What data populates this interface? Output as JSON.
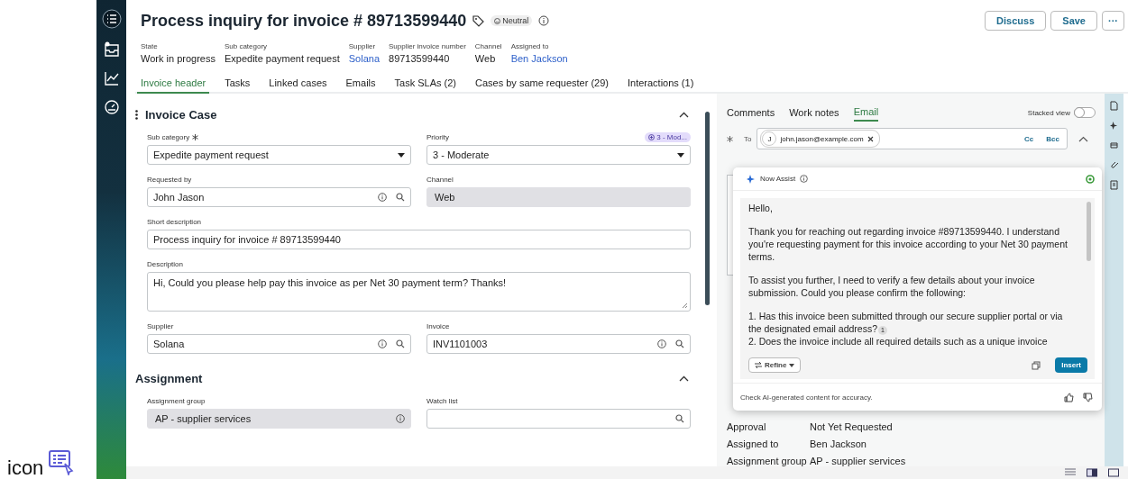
{
  "caption": {
    "text": "icon"
  },
  "header": {
    "title": "Process inquiry for invoice # 89713599440",
    "sentiment": "Neutral",
    "buttons": [
      {
        "label": "Discuss",
        "kind": "text"
      },
      {
        "label": "Save",
        "kind": "text"
      },
      {
        "label": "···",
        "kind": "more"
      }
    ]
  },
  "summary": [
    {
      "label": "State",
      "value": "Work in progress",
      "link": false
    },
    {
      "label": "Sub category",
      "value": "Expedite payment request",
      "link": false
    },
    {
      "label": "Supplier",
      "value": "Solana",
      "link": true
    },
    {
      "label": "Supplier invoice number",
      "value": "89713599440",
      "link": false
    },
    {
      "label": "Channel",
      "value": "Web",
      "link": false
    },
    {
      "label": "Assigned to",
      "value": "Ben Jackson",
      "link": true
    }
  ],
  "tabs": [
    {
      "label": "Invoice header",
      "selected": true
    },
    {
      "label": "Tasks",
      "selected": false
    },
    {
      "label": "Linked cases",
      "selected": false
    },
    {
      "label": "Emails",
      "selected": false
    },
    {
      "label": "Task SLAs (2)",
      "selected": false
    },
    {
      "label": "Cases by same requester (29)",
      "selected": false
    },
    {
      "label": "Interactions (1)",
      "selected": false
    }
  ],
  "sections": [
    {
      "title": "Invoice Case",
      "expanded": true,
      "fields": [
        {
          "label": "Sub category",
          "value": "Expedite payment request",
          "kind": "select",
          "required": true
        },
        {
          "label": "Priority",
          "value": "3 - Moderate",
          "kind": "select",
          "required": false,
          "badge": "3 - Mod..."
        },
        {
          "label": "Requested by",
          "value": "John Jason",
          "kind": "lookup",
          "required": false
        },
        {
          "label": "Channel",
          "value": "Web",
          "kind": "readonly",
          "required": false
        },
        {
          "label": "Short description",
          "value": "Process inquiry for invoice # 89713599440",
          "kind": "text",
          "required": false
        },
        {
          "label": "Description",
          "value": "Hi, Could you please help pay this invoice as per Net 30 payment term? Thanks!",
          "kind": "textarea",
          "required": false
        },
        {
          "label": "Supplier",
          "value": "Solana",
          "kind": "lookup",
          "required": false
        },
        {
          "label": "Invoice",
          "value": "INV1101003",
          "kind": "lookup",
          "required": false
        }
      ]
    },
    {
      "title": "Assignment",
      "expanded": true,
      "fields": [
        {
          "label": "Assignment group",
          "value": "AP - supplier services",
          "kind": "readonly-info",
          "required": false
        },
        {
          "label": "Watch list",
          "kind": "search",
          "required": false
        }
      ]
    }
  ],
  "activity": {
    "tabs": [
      {
        "label": "Comments",
        "selected": false
      },
      {
        "label": "Work notes",
        "selected": false
      },
      {
        "label": "Email",
        "selected": true
      }
    ],
    "stacked_view": {
      "label": "Stacked view",
      "on": false
    },
    "to_label": "To",
    "recipient_initial": "J",
    "recipient": "john.jason@example.com",
    "cc": "Cc",
    "bcc": "Bcc",
    "details": [
      {
        "label": "Approval",
        "value": "Not Yet Requested"
      },
      {
        "label": "Assigned to",
        "value": "Ben Jackson"
      },
      {
        "label": "Assignment group",
        "value": "AP - supplier services"
      }
    ]
  },
  "assist": {
    "title": "Now Assist",
    "paragraphs": [
      {
        "lines": [
          {
            "text": "Hello,"
          }
        ]
      },
      {
        "lines": [
          {
            "text": "Thank you for reaching out regarding invoice #89713599440. I understand you're requesting payment for this invoice according to your Net 30 payment terms."
          }
        ]
      },
      {
        "lines": [
          {
            "text": "To assist you further, I need to verify a few details about your invoice submission. Could you please confirm the following:"
          }
        ]
      },
      {
        "lines": [
          {
            "text": "1. Has this invoice been submitted through our secure supplier portal or via the designated email address?",
            "citation": "1"
          },
          {
            "text": "2. Does the invoice include all required details such as a unique invoice"
          }
        ]
      }
    ],
    "refine": "Refine",
    "insert": "Insert",
    "disclaimer": "Check AI-generated content for accuracy."
  }
}
